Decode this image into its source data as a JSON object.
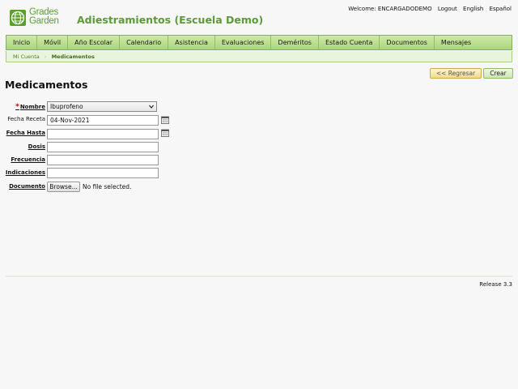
{
  "header": {
    "logo_line1": "Grades",
    "logo_line2": "Garden",
    "title": "Adiestramientos (Escuela Demo)",
    "welcome": "Welcome: ENCARGADODEMO",
    "logout": "Logout",
    "lang_en": "English",
    "lang_es": "Español"
  },
  "nav": {
    "items": [
      "Inicio",
      "Móvil",
      "Año Escolar",
      "Calendario",
      "Asistencia",
      "Evaluaciones",
      "Deméritos",
      "Estado Cuenta",
      "Documentos",
      "Mensajes"
    ]
  },
  "breadcrumb": {
    "parent": "Mi Cuenta",
    "separator": "›",
    "current": "Medicamentos"
  },
  "actions": {
    "back": "<< Regresar",
    "create": "Crear"
  },
  "page": {
    "title": "Medicamentos"
  },
  "form": {
    "required_mark": "*",
    "nombre_label": "Nombre",
    "nombre_value": "Ibuprofeno",
    "fecha_receta_label": "Fecha Receta",
    "fecha_receta_value": "04-Nov-2021",
    "fecha_hasta_label": "Fecha Hasta",
    "fecha_hasta_value": "",
    "dosis_label": "Dosis",
    "dosis_value": "",
    "frecuencia_label": "Frecuencia",
    "frecuencia_value": "",
    "indicaciones_label": "Indicaciones",
    "indicaciones_value": "",
    "documento_label": "Documento",
    "browse_label": "Browse...",
    "file_status": "No file selected."
  },
  "footer": {
    "release": "Release 3.3"
  },
  "colors": {
    "brand_green": "#5b9b35",
    "nav_bg": "#b8dc8c",
    "required": "#cc0000",
    "back_button": "#f3d98a"
  }
}
